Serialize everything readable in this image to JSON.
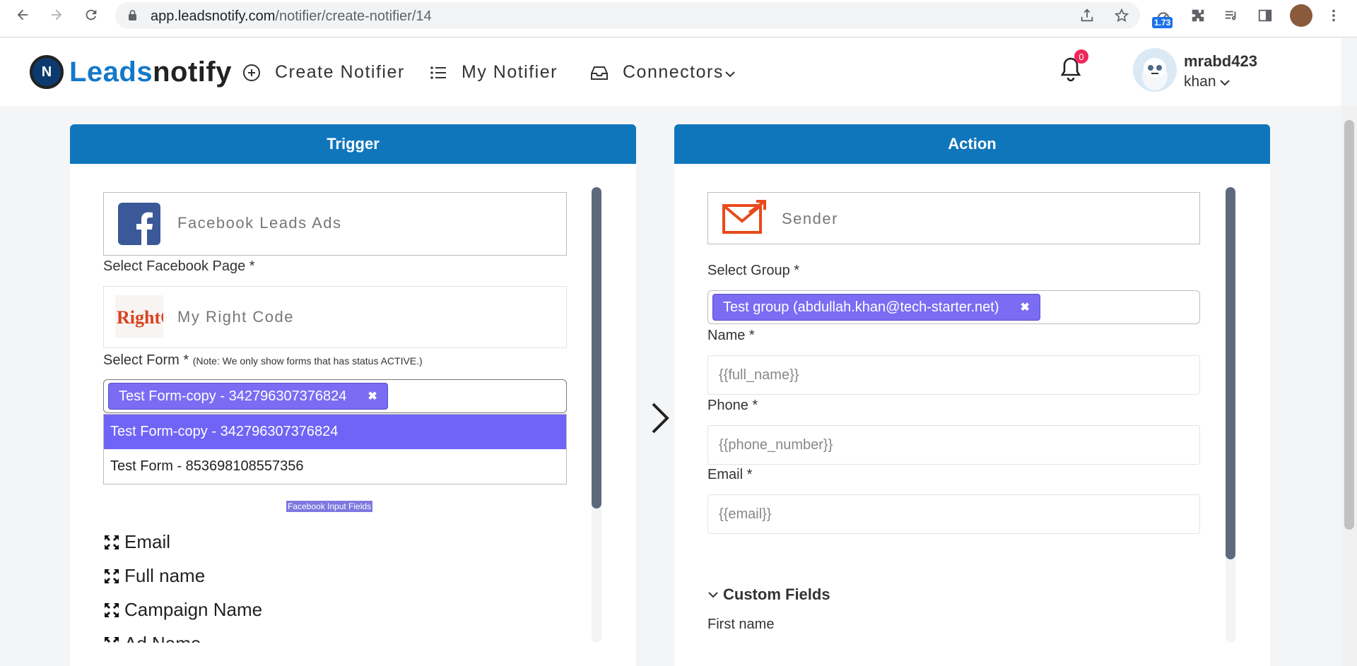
{
  "browser": {
    "url_domain": "app.leadsnotify.com",
    "url_path": "/notifier/create-notifier/14",
    "extension_badge": "1.73"
  },
  "app": {
    "logo_text_a": "Leads",
    "logo_text_b": "notify",
    "nav": {
      "create": "Create Notifier",
      "my": "My Notifier",
      "connectors": "Connectors"
    },
    "notification_count": "0",
    "user": {
      "name": "mrabd423",
      "sub": "khan"
    }
  },
  "trigger": {
    "title": "Trigger",
    "app_name": "Facebook Leads Ads",
    "page_label": "Select Facebook Page *",
    "page_name": "My Right Code",
    "page_logo_text": "RightCo",
    "form_label": "Select Form *",
    "form_note": "(Note: We only show forms that has status ACTIVE.)",
    "selected_form": "Test Form-copy - 342796307376824",
    "form_options": [
      "Test Form-copy - 342796307376824",
      "Test Form - 853698108557356"
    ],
    "fields_title": "Facebook Input Fields",
    "fields": [
      "Email",
      "Full name",
      "Campaign Name",
      "Ad Name"
    ]
  },
  "action": {
    "title": "Action",
    "app_name": "Sender",
    "group_label": "Select Group *",
    "selected_group": "Test group (abdullah.khan@tech-starter.net)",
    "name_label": "Name *",
    "name_value": "{{full_name}}",
    "phone_label": "Phone *",
    "phone_value": "{{phone_number}}",
    "email_label": "Email *",
    "email_value": "{{email}}",
    "custom_fields_label": "Custom Fields",
    "first_name_label": "First name"
  },
  "colors": {
    "primary": "#1076bc",
    "tag": "#7a6cf3",
    "active_option": "#7064f7",
    "badge": "#f0285a"
  }
}
